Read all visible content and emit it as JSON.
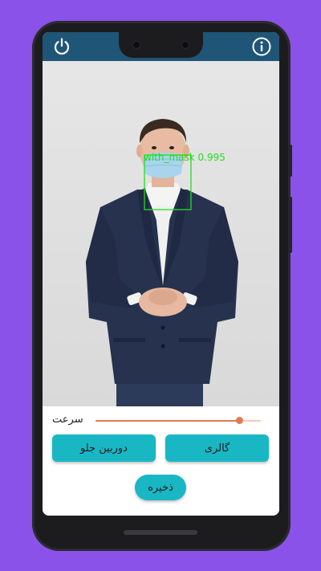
{
  "app": {
    "colors": {
      "background": "#8a52e8",
      "appbar": "#1f5577",
      "button": "#19b7c4",
      "slider": "#e07a4f",
      "detection": "#22dd22"
    },
    "icons": {
      "power": "power-icon",
      "info": "info-icon"
    }
  },
  "detection": {
    "label": "with_mask 0.995"
  },
  "controls": {
    "speed_label": "سرعت",
    "speed_value": 0.87,
    "front_camera_label": "دوربین جلو",
    "gallery_label": "گالری",
    "save_label": "ذخیره"
  }
}
